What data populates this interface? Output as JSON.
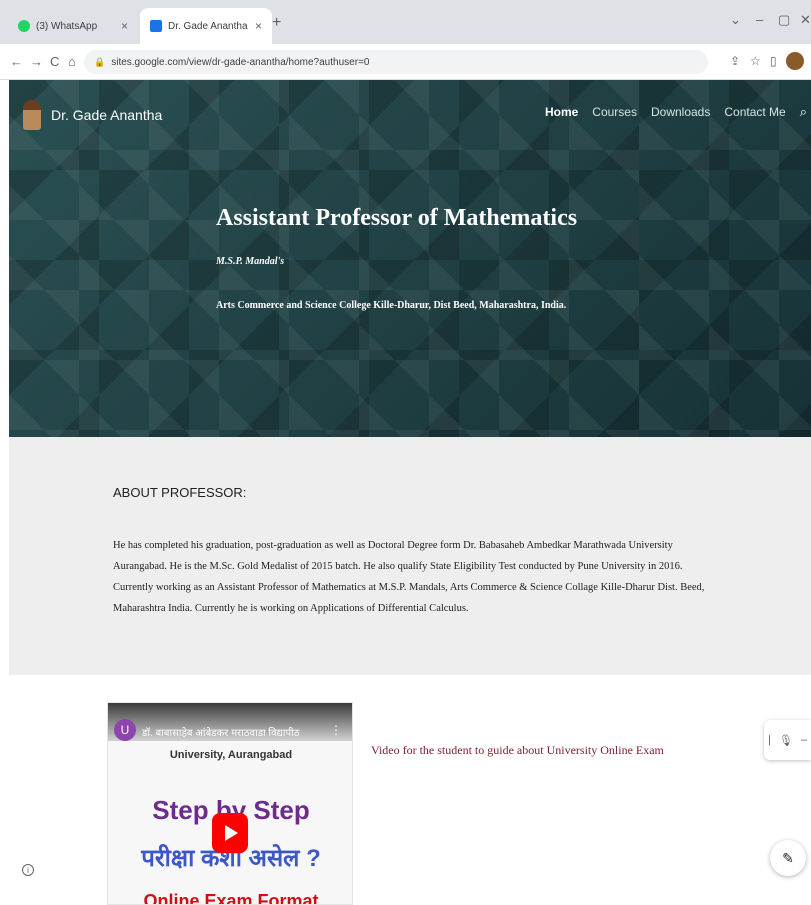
{
  "browser": {
    "tabs": [
      {
        "title": "(3) WhatsApp",
        "active": false,
        "close": "×"
      },
      {
        "title": "Dr. Gade Anantha",
        "active": true,
        "close": "×"
      }
    ],
    "new_tab": "+",
    "window_controls": {
      "minimize": "–",
      "maximize": "▢",
      "close": "✕",
      "tab_search": "⌄"
    },
    "nav": {
      "back": "←",
      "forward": "→",
      "reload": "C",
      "home": "⌂"
    },
    "url": "sites.google.com/view/dr-gade-anantha/home?authuser=0",
    "toolbar_icons": {
      "share": "⇪",
      "star": "☆",
      "sidepanel": "▯",
      "menu": "⋮"
    }
  },
  "site": {
    "brand": "Dr. Gade Anantha",
    "nav": [
      "Home",
      "Courses",
      "Downloads",
      "Contact Me"
    ],
    "search_glyph": "⌕",
    "hero": {
      "title": "Assistant Professor of Mathematics",
      "subtitle": "M.S.P. Mandal's",
      "college": "Arts Commerce and Science College Kille-Dharur, Dist Beed, Maharashtra, India."
    },
    "about": {
      "heading": "ABOUT PROFESSOR:",
      "body": "He has completed his graduation, post-graduation as well as Doctoral Degree form Dr. Babasaheb Ambedkar Marathwada University Aurangabad. He is the M.Sc. Gold Medalist of 2015 batch. He also qualify State Eligibility Test conducted by Pune University in 2016. Currently working as an Assistant Professor of Mathematics at M.S.P. Mandals, Arts Commerce & Science Collage Kille-Dharur Dist. Beed, Maharashtra India. Currently he is working on Applications of Differential Calculus."
    },
    "video": {
      "channel_initial": "U",
      "title": "डॉ. बाबासाहेब आंबेडकर मराठवाडा विद्यापीठ",
      "menu": "⋮",
      "thumb_univ": "University, Aurangabad",
      "thumb_step": "Step by Step",
      "thumb_hindi": "परीक्षा कशी असेल ?",
      "thumb_format": "Online Exam Format",
      "caption": "Video for the student to guide about University Online Exam"
    },
    "side_tool": {
      "divider": "|",
      "mic": "🎙",
      "dash": "–"
    },
    "edit_glyph": "✎",
    "info_glyph": "i"
  }
}
